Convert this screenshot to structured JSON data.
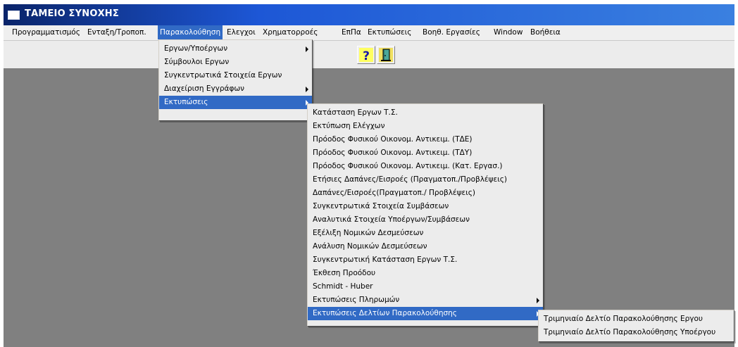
{
  "window": {
    "title": "ΤΑΜΕΙΟ ΣΥΝΟΧΗΣ"
  },
  "menubar": [
    {
      "label": "Προγραμματισμός"
    },
    {
      "label": "Ενταξη/Τροποπ."
    },
    {
      "label": "Παρακολούθηση"
    },
    {
      "label": "Ελεγχοι"
    },
    {
      "label": "Χρηματορροές"
    },
    {
      "label": "ΕπΠα"
    },
    {
      "label": "Εκτυπώσεις"
    },
    {
      "label": "Βοηθ. Εργασίες"
    },
    {
      "label": "Window"
    },
    {
      "label": "Βοήθεια"
    }
  ],
  "toolbar": {
    "help_icon": "question-mark-icon",
    "exit_icon": "exit-door-icon"
  },
  "menu1": [
    {
      "label": "Εργων/Υποέργων",
      "submenu": true
    },
    {
      "label": "Σύμβουλοι Εργων",
      "submenu": false
    },
    {
      "label": "Συγκεντρωτικά Στοιχεία Εργων",
      "submenu": false
    },
    {
      "label": "Διαχείριση Εγγράφων",
      "submenu": true
    },
    {
      "label": "Εκτυπώσεις",
      "submenu": true
    }
  ],
  "menu2": [
    {
      "label": "Κατάσταση Εργων Τ.Σ.",
      "submenu": false
    },
    {
      "label": "Εκτύπωση Ελέγχων",
      "submenu": false
    },
    {
      "label": "Πρόοδος Φυσικού Οικονομ. Αντικειμ. (ΤΔΕ)",
      "submenu": false
    },
    {
      "label": "Πρόοδος Φυσικού Οικονομ. Αντικειμ. (ΤΔΥ)",
      "submenu": false
    },
    {
      "label": "Πρόοδος Φυσικού Οικονομ. Αντικειμ. (Κατ. Εργασ.)",
      "submenu": false
    },
    {
      "label": "Ετήσιες Δαπάνες/Εισροές (Πραγματοπ./Προβλέψεις)",
      "submenu": false
    },
    {
      "label": "Δαπάνες/Εισροές(Πραγματοπ./ Προβλέψεις)",
      "submenu": false
    },
    {
      "label": "Συγκεντρωτικά Στοιχεία Συμβάσεων",
      "submenu": false
    },
    {
      "label": "Αναλυτικά Στοιχεία Υποέργων/Συμβάσεων",
      "submenu": false
    },
    {
      "label": "Εξέλιξη Νομικών Δεσμεύσεων",
      "submenu": false
    },
    {
      "label": "Ανάλυση Νομικών Δεσμεύσεων",
      "submenu": false
    },
    {
      "label": "Συγκεντρωτική Κατάσταση Εργων Τ.Σ.",
      "submenu": false
    },
    {
      "label": "Έκθεση Προόδου",
      "submenu": false
    },
    {
      "label": "Schmidt - Huber",
      "submenu": false
    },
    {
      "label": "Εκτυπώσεις Πληρωμών",
      "submenu": true
    },
    {
      "label": "Εκτυπώσεις Δελτίων Παρακολούθησης",
      "submenu": true
    }
  ],
  "menu3": [
    {
      "label": "Τριμηνιαίο Δελτίο Παρακολούθησης Εργου"
    },
    {
      "label": "Τριμηνιαίο Δελτίο Παρακολούθησης Υποέργου"
    }
  ],
  "colors": {
    "desktop": "#808080",
    "highlight": "#316ac5",
    "title_start": "#0a246a",
    "title_end": "#3a80e0"
  }
}
